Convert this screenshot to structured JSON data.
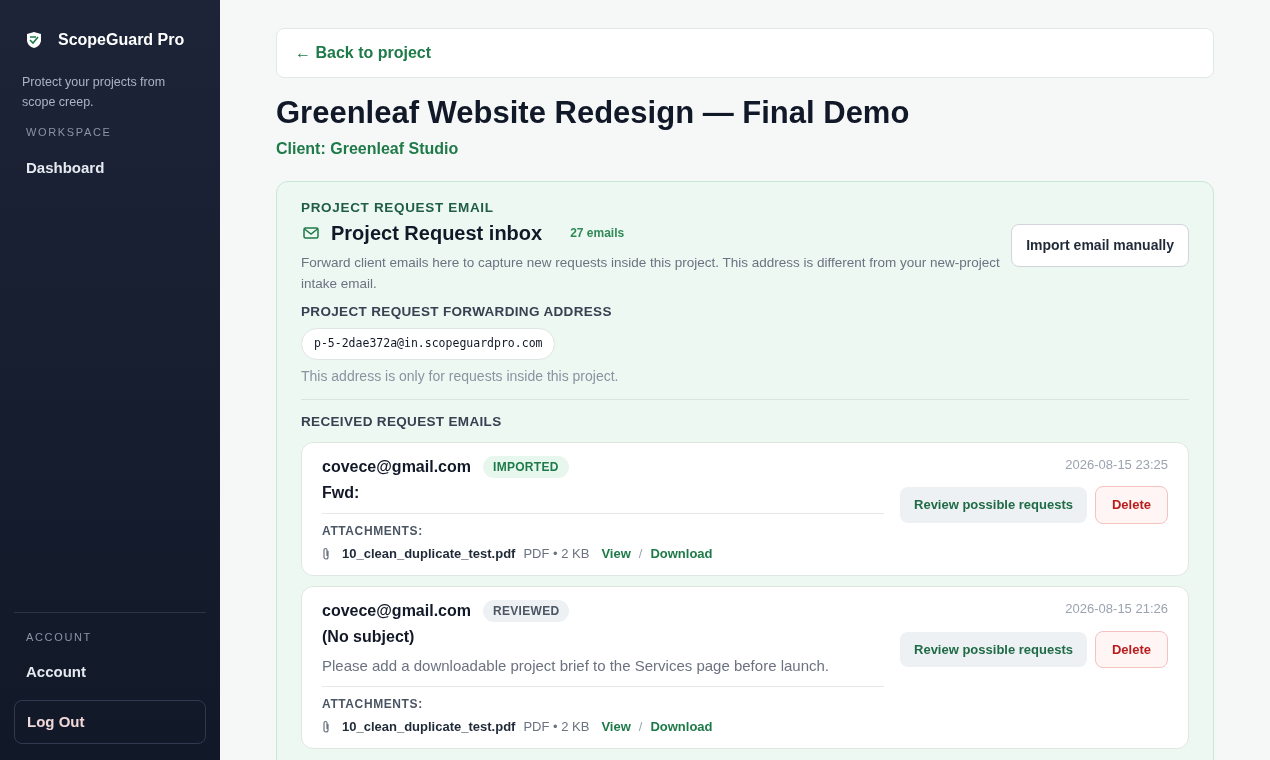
{
  "sidebar": {
    "brand": "ScopeGuard Pro",
    "tagline": "Protect your projects from scope creep.",
    "sections": [
      {
        "heading": "WORKSPACE",
        "items": [
          {
            "label": "Dashboard"
          }
        ]
      }
    ],
    "account_heading": "ACCOUNT",
    "account_item": "Account",
    "logout": "Log Out"
  },
  "back_link": "← Back to project",
  "title": "Greenleaf Website Redesign — Final Demo",
  "client": "Client: Greenleaf Studio",
  "panel": {
    "eyebrow": "PROJECT REQUEST EMAIL",
    "heading": "Project Request inbox",
    "count": "27 emails",
    "description": "Forward client emails here to capture new requests inside this project. This address is different from your new-project intake email.",
    "import_button": "Import email manually",
    "address_label": "PROJECT REQUEST FORWARDING ADDRESS",
    "address": "p-5-2dae372a@in.scopeguardpro.com",
    "address_note": "This address is only for requests inside this project.",
    "received_heading": "RECEIVED REQUEST EMAILS",
    "emails": [
      {
        "from": "covece@gmail.com",
        "status": {
          "kind": "imported",
          "label": "IMPORTED"
        },
        "date": "2026-08-15 23:25",
        "subject": "Fwd:",
        "attachments_label": "ATTACHMENTS:",
        "attachments": [
          {
            "name": "10_clean_duplicate_test.pdf",
            "meta": "PDF • 2 KB",
            "view": "View",
            "sep": "/",
            "download": "Download"
          }
        ],
        "review": "Review possible requests",
        "delete": "Delete"
      },
      {
        "from": "covece@gmail.com",
        "status": {
          "kind": "reviewed",
          "label": "REVIEWED"
        },
        "date": "2026-08-15 21:26",
        "subject": "(No subject)",
        "body": "Please add a downloadable project brief to the Services page before launch.",
        "attachments_label": "ATTACHMENTS:",
        "attachments": [
          {
            "name": "10_clean_duplicate_test.pdf",
            "meta": "PDF • 2 KB",
            "view": "View",
            "sep": "/",
            "download": "Download"
          }
        ],
        "review": "Review possible requests",
        "delete": "Delete"
      }
    ]
  }
}
